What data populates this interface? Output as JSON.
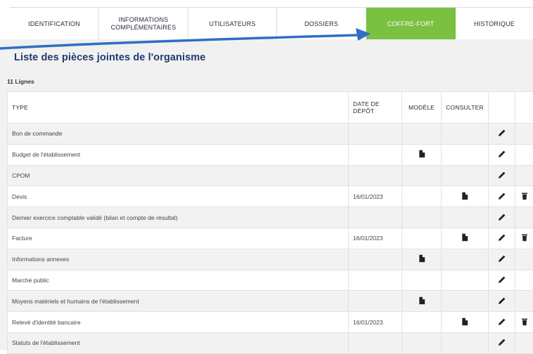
{
  "tabs": [
    {
      "label_line1": "IDENTIFICATION",
      "label_line2": ""
    },
    {
      "label_line1": "INFORMATIONS",
      "label_line2": "COMPLÉMENTAIRES"
    },
    {
      "label_line1": "UTILISATEURS",
      "label_line2": ""
    },
    {
      "label_line1": "DOSSIERS",
      "label_line2": ""
    },
    {
      "label_line1": "COFFRE-FORT",
      "label_line2": ""
    },
    {
      "label_line1": "HISTORIQUE",
      "label_line2": ""
    }
  ],
  "active_tab": "COFFRE-FORT",
  "colors": {
    "accent": "#7ac142",
    "title": "#1f3b6e",
    "arrow": "#2e6fc4"
  },
  "page_title": "Liste des pièces jointes de l'organisme",
  "row_count": "11 Lignes",
  "table": {
    "headers": {
      "type": "TYPE",
      "date_line1": "DATE DE",
      "date_line2": "DÉPÔT",
      "model": "MODÈLE",
      "consult": "CONSULTER"
    },
    "rows": [
      {
        "type": "Bon de commande",
        "date": "",
        "model_icon": "",
        "consult_icon": "",
        "edit_icon": "pencil-icon",
        "delete_icon": ""
      },
      {
        "type": "Budget de l'établissement",
        "date": "",
        "model_icon": "document-icon",
        "consult_icon": "",
        "edit_icon": "pencil-icon",
        "delete_icon": ""
      },
      {
        "type": "CPOM",
        "date": "",
        "model_icon": "",
        "consult_icon": "",
        "edit_icon": "pencil-icon",
        "delete_icon": ""
      },
      {
        "type": "Devis",
        "date": "16/01/2023",
        "model_icon": "",
        "consult_icon": "document-icon",
        "edit_icon": "pencil-icon",
        "delete_icon": "trash-icon"
      },
      {
        "type": "Dernier exercice comptable validé (bilan et compte de résultat)",
        "date": "",
        "model_icon": "",
        "consult_icon": "",
        "edit_icon": "pencil-icon",
        "delete_icon": ""
      },
      {
        "type": "Facture",
        "date": "16/01/2023",
        "model_icon": "",
        "consult_icon": "document-icon",
        "edit_icon": "pencil-icon",
        "delete_icon": "trash-icon"
      },
      {
        "type": "Informations annexes",
        "date": "",
        "model_icon": "document-icon",
        "consult_icon": "",
        "edit_icon": "pencil-icon",
        "delete_icon": ""
      },
      {
        "type": "Marché public",
        "date": "",
        "model_icon": "",
        "consult_icon": "",
        "edit_icon": "pencil-icon",
        "delete_icon": ""
      },
      {
        "type": "Moyens matériels et humains de l'établissement",
        "date": "",
        "model_icon": "document-icon",
        "consult_icon": "",
        "edit_icon": "pencil-icon",
        "delete_icon": ""
      },
      {
        "type": "Relevé d'identité bancaire",
        "date": "16/01/2023",
        "model_icon": "",
        "consult_icon": "document-icon",
        "edit_icon": "pencil-icon",
        "delete_icon": "trash-icon"
      },
      {
        "type": "Statuts de l'établissement",
        "date": "",
        "model_icon": "",
        "consult_icon": "",
        "edit_icon": "pencil-icon",
        "delete_icon": ""
      }
    ]
  }
}
